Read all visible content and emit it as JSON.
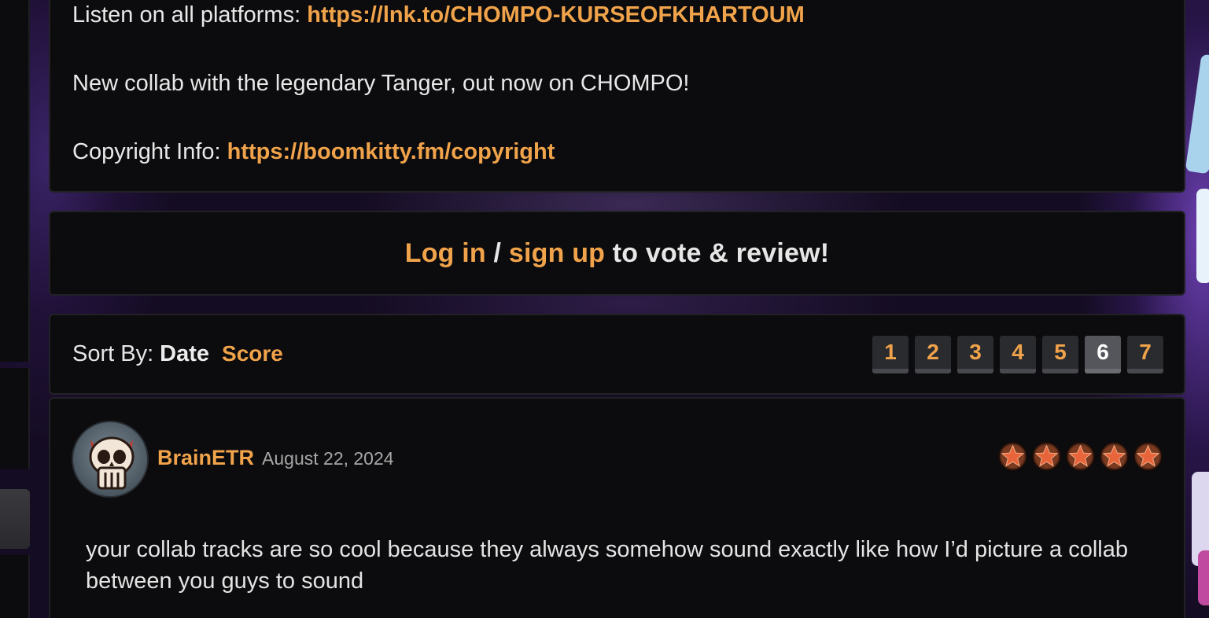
{
  "description": {
    "listen_label": "Listen on all platforms: ",
    "listen_link": "https://lnk.to/CHOMPO-KURSEOFKHARTOUM",
    "collab_text": "New collab with the legendary Tanger, out now on CHOMPO!",
    "copyright_label": "Copyright Info: ",
    "copyright_link": "https://boomkitty.fm/copyright"
  },
  "login_prompt": {
    "login_link": "Log in",
    "separator": " / ",
    "signup_link": "sign up",
    "suffix": " to vote & review!"
  },
  "sort": {
    "label": "Sort By: ",
    "active": "Date",
    "option": "Score"
  },
  "pagination": {
    "pages": [
      "1",
      "2",
      "3",
      "4",
      "5",
      "6",
      "7"
    ],
    "current": "6"
  },
  "review": {
    "username": "BrainETR",
    "date": "August 22, 2024",
    "rating": 5,
    "rating_max": 5,
    "text": "your collab tracks are so cool because they always somehow sound exactly like how I’d picture a collab between you guys to sound"
  },
  "colors": {
    "accent": "#f0a34a",
    "panel": "#0c0b0d",
    "star": "#e8643a"
  }
}
